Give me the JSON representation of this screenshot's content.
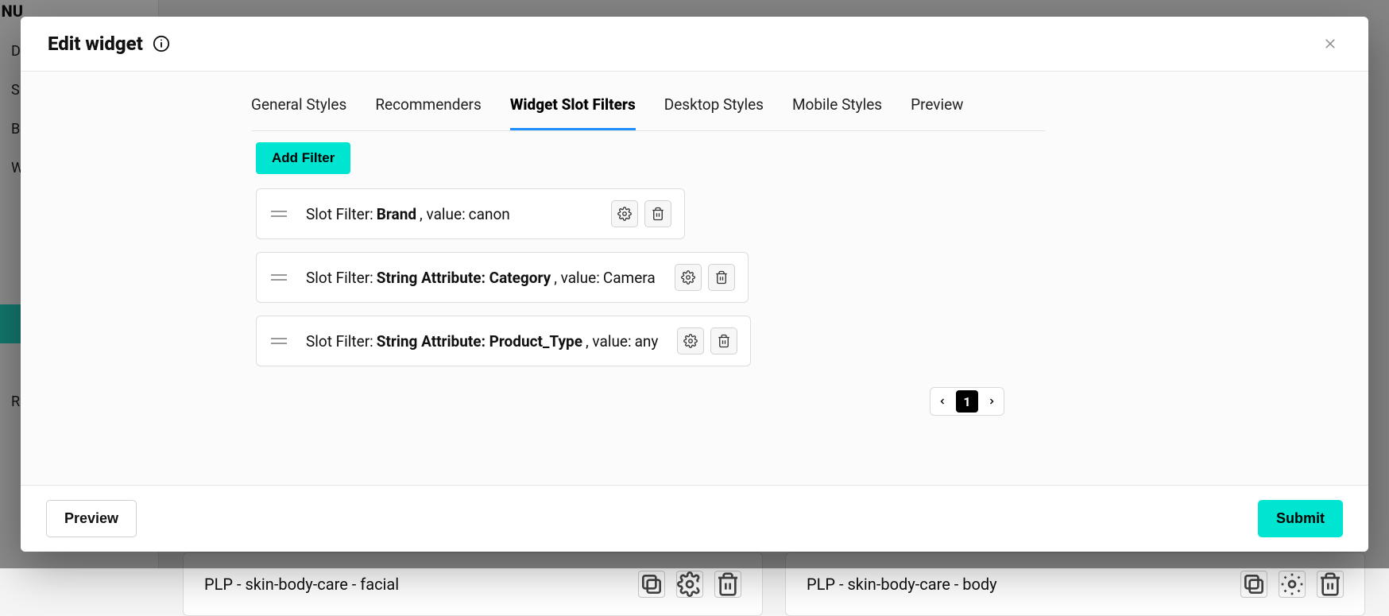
{
  "bg": {
    "menu_header": "NU",
    "sidebar_items": [
      "Da",
      "Su",
      "Bo",
      "Wo",
      "",
      "",
      "",
      "",
      "Re"
    ],
    "active_index": 7,
    "card_left_title": "PLP - skin-body-care - facial",
    "card_right_title": "PLP - skin-body-care - body"
  },
  "modal": {
    "title": "Edit widget",
    "tabs": [
      "General Styles",
      "Recommenders",
      "Widget Slot Filters",
      "Desktop Styles",
      "Mobile Styles",
      "Preview"
    ],
    "active_tab": "Widget Slot Filters",
    "add_filter_label": "Add Filter",
    "filter_label_prefix": "Slot Filter: ",
    "value_prefix": ", value: ",
    "filters": [
      {
        "attr": "Brand",
        "value": "canon"
      },
      {
        "attr": "String Attribute: Category",
        "value": "Camera"
      },
      {
        "attr": "String Attribute: Product_Type",
        "value": "any"
      }
    ],
    "pagination": {
      "current": "1"
    },
    "footer": {
      "preview": "Preview",
      "submit": "Submit"
    }
  }
}
